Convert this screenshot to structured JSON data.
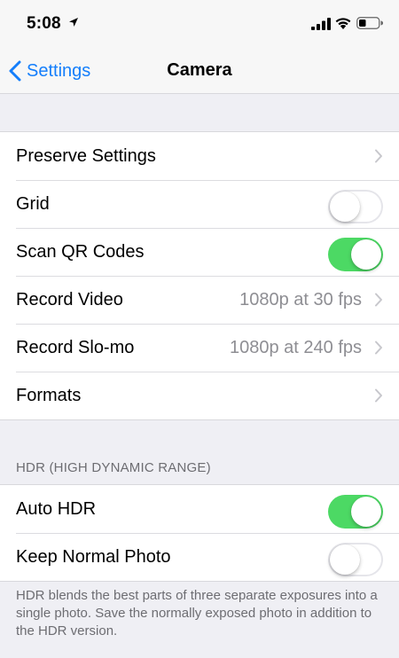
{
  "status_bar": {
    "time": "5:08"
  },
  "nav": {
    "back_label": "Settings",
    "title": "Camera"
  },
  "group1": {
    "rows": [
      {
        "label": "Preserve Settings",
        "value": "",
        "type": "disclosure"
      },
      {
        "label": "Grid",
        "type": "toggle",
        "on": false
      },
      {
        "label": "Scan QR Codes",
        "type": "toggle",
        "on": true
      },
      {
        "label": "Record Video",
        "value": "1080p at 30 fps",
        "type": "disclosure"
      },
      {
        "label": "Record Slo-mo",
        "value": "1080p at 240 fps",
        "type": "disclosure"
      },
      {
        "label": "Formats",
        "value": "",
        "type": "disclosure"
      }
    ]
  },
  "hdr_section": {
    "header": "HDR (HIGH DYNAMIC RANGE)",
    "rows": [
      {
        "label": "Auto HDR",
        "type": "toggle",
        "on": true
      },
      {
        "label": "Keep Normal Photo",
        "type": "toggle",
        "on": false
      }
    ],
    "footer": "HDR blends the best parts of three separate exposures into a single photo. Save the normally exposed photo in addition to the HDR version."
  },
  "colors": {
    "accent": "#147efb",
    "toggle_on": "#4cd964",
    "background": "#efeff4",
    "secondary_text": "#8e8e93"
  }
}
